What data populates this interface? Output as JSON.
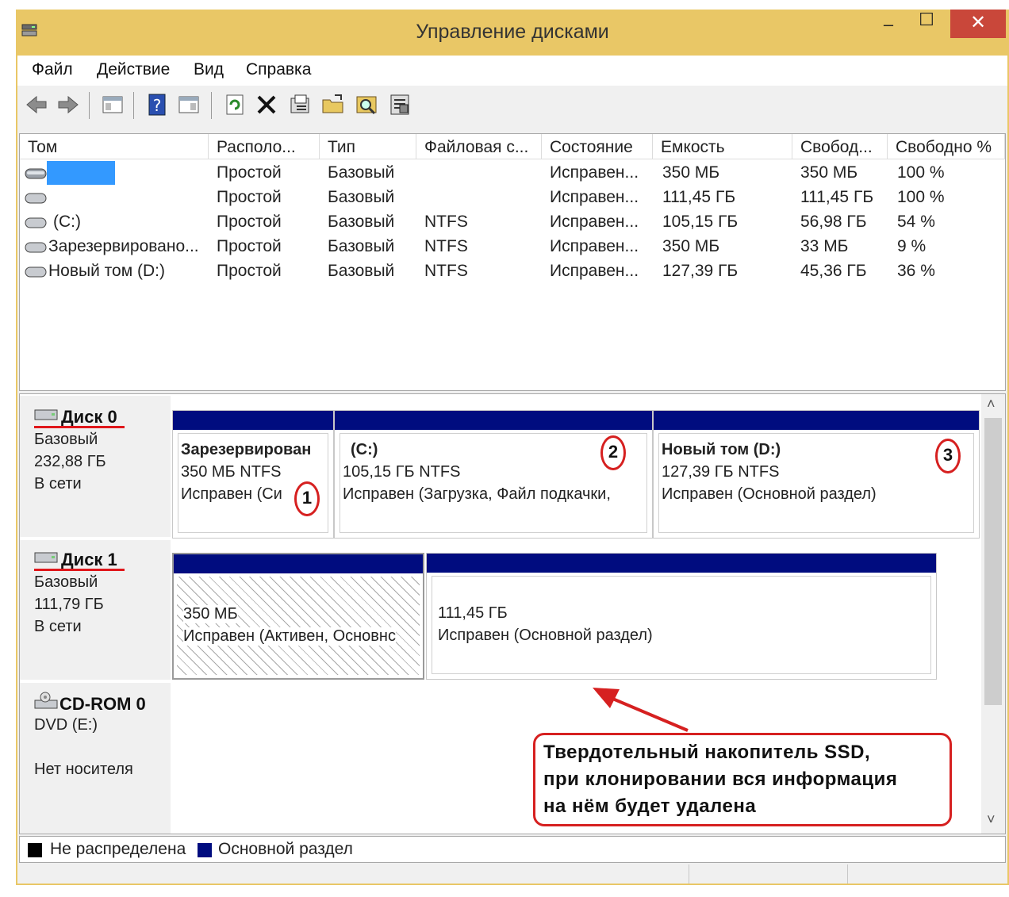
{
  "window": {
    "title": "Управление дисками",
    "minimize": "–",
    "maximize": "☐",
    "close": "✕"
  },
  "menu": [
    "Файл",
    "Действие",
    "Вид",
    "Справка"
  ],
  "toolbar": [
    "back-icon",
    "forward-icon",
    "console-tree-icon",
    "help-icon",
    "show-hide-icon",
    "refresh-icon",
    "delete-icon",
    "properties-icon",
    "open-icon",
    "find-icon",
    "settings-icon"
  ],
  "volumes": {
    "columns": [
      "Том",
      "Располо...",
      "Тип",
      "Файловая с...",
      "Состояние",
      "Емкость",
      "Свобод...",
      "Свободно %"
    ],
    "rows": [
      [
        "",
        "Простой",
        "Базовый",
        "",
        "Исправен...",
        "350 МБ",
        "350 МБ",
        "100 %"
      ],
      [
        "",
        "Простой",
        "Базовый",
        "",
        "Исправен...",
        "111,45 ГБ",
        "111,45 ГБ",
        "100 %"
      ],
      [
        "(C:)",
        "Простой",
        "Базовый",
        "NTFS",
        "Исправен...",
        "105,15 ГБ",
        "56,98 ГБ",
        "54 %"
      ],
      [
        "Зарезервировано...",
        "Простой",
        "Базовый",
        "NTFS",
        "Исправен...",
        "350 МБ",
        "33 МБ",
        "9 %"
      ],
      [
        "Новый том (D:)",
        "Простой",
        "Базовый",
        "NTFS",
        "Исправен...",
        "127,39 ГБ",
        "45,36 ГБ",
        "36 %"
      ]
    ]
  },
  "disks": [
    {
      "name": "Диск 0",
      "type": "Базовый",
      "size": "232,88 ГБ",
      "status": "В сети",
      "partitions": [
        {
          "title": "Зарезервирован",
          "size": "350 МБ NTFS",
          "state": "Исправен (Си",
          "marker": "1"
        },
        {
          "title": "(C:)",
          "size": "105,15 ГБ NTFS",
          "state": "Исправен (Загрузка, Файл подкачки,",
          "marker": "2"
        },
        {
          "title": "Новый том  (D:)",
          "size": "127,39 ГБ NTFS",
          "state": "Исправен (Основной раздел)",
          "marker": "3"
        }
      ]
    },
    {
      "name": "Диск 1",
      "type": "Базовый",
      "size": "111,79 ГБ",
      "status": "В сети",
      "partitions": [
        {
          "size": "350 МБ",
          "state": "Исправен (Активен, Основнс"
        },
        {
          "size": "111,45 ГБ",
          "state": "Исправен (Основной раздел)"
        }
      ]
    }
  ],
  "cdrom": {
    "name": "CD-ROM 0",
    "drive": "DVD (E:)",
    "media": "Нет носителя"
  },
  "legend": [
    {
      "label": "Не распределена",
      "color": "#000000"
    },
    {
      "label": "Основной раздел",
      "color": "#000c7f"
    }
  ],
  "callout": [
    "Твердотельный накопитель SSD,",
    "при клонировании вся информация",
    "на нём будет удалена"
  ],
  "colors": {
    "titlebar": "#e9c766",
    "partition_bar": "#000c7f",
    "annotation": "#d62020",
    "selection": "#3399ff"
  }
}
